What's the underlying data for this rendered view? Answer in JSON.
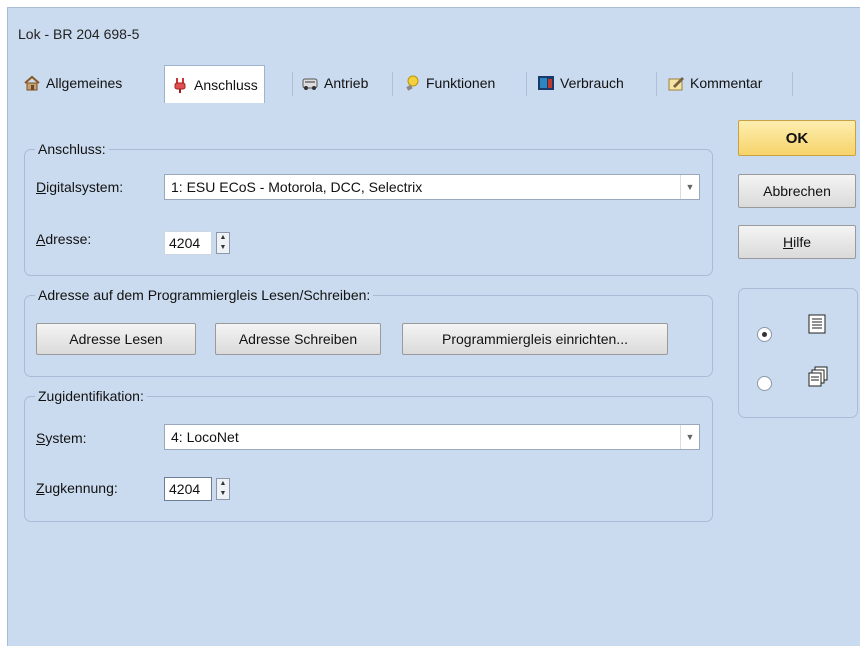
{
  "window": {
    "title": "Lok - BR 204 698-5"
  },
  "tabs": [
    {
      "label": "Allgemeines",
      "icon": "house-icon"
    },
    {
      "label": "Anschluss",
      "icon": "plug-icon",
      "active": true
    },
    {
      "label": "Antrieb",
      "icon": "engine-icon"
    },
    {
      "label": "Funktionen",
      "icon": "bulb-icon"
    },
    {
      "label": "Verbrauch",
      "icon": "fuel-icon"
    },
    {
      "label": "Kommentar",
      "icon": "note-icon"
    }
  ],
  "anschluss": {
    "title": "Anschluss:",
    "digital_label": "Digitalsystem:",
    "digital_value": "1: ESU ECoS - Motorola, DCC, Selectrix",
    "adresse_label": "Adresse:",
    "adresse_value": "4204"
  },
  "programmier": {
    "title": "Adresse auf dem Programmiergleis Lesen/Schreiben:",
    "btn_lesen": "Adresse Lesen",
    "btn_schreiben": "Adresse Schreiben",
    "btn_einrichten": "Programmiergleis einrichten..."
  },
  "zugid": {
    "title": "Zugidentifikation:",
    "system_label": "System:",
    "system_value": "4: LocoNet",
    "kennung_label": "Zugkennung:",
    "kennung_value": "4204"
  },
  "buttons": {
    "ok": "OK",
    "cancel": "Abbrechen",
    "help": "Hilfe"
  },
  "view": {
    "list_selected": true
  },
  "colors": {
    "window_bg": "#cbdbef",
    "ok_bg": "#f7d36a"
  }
}
